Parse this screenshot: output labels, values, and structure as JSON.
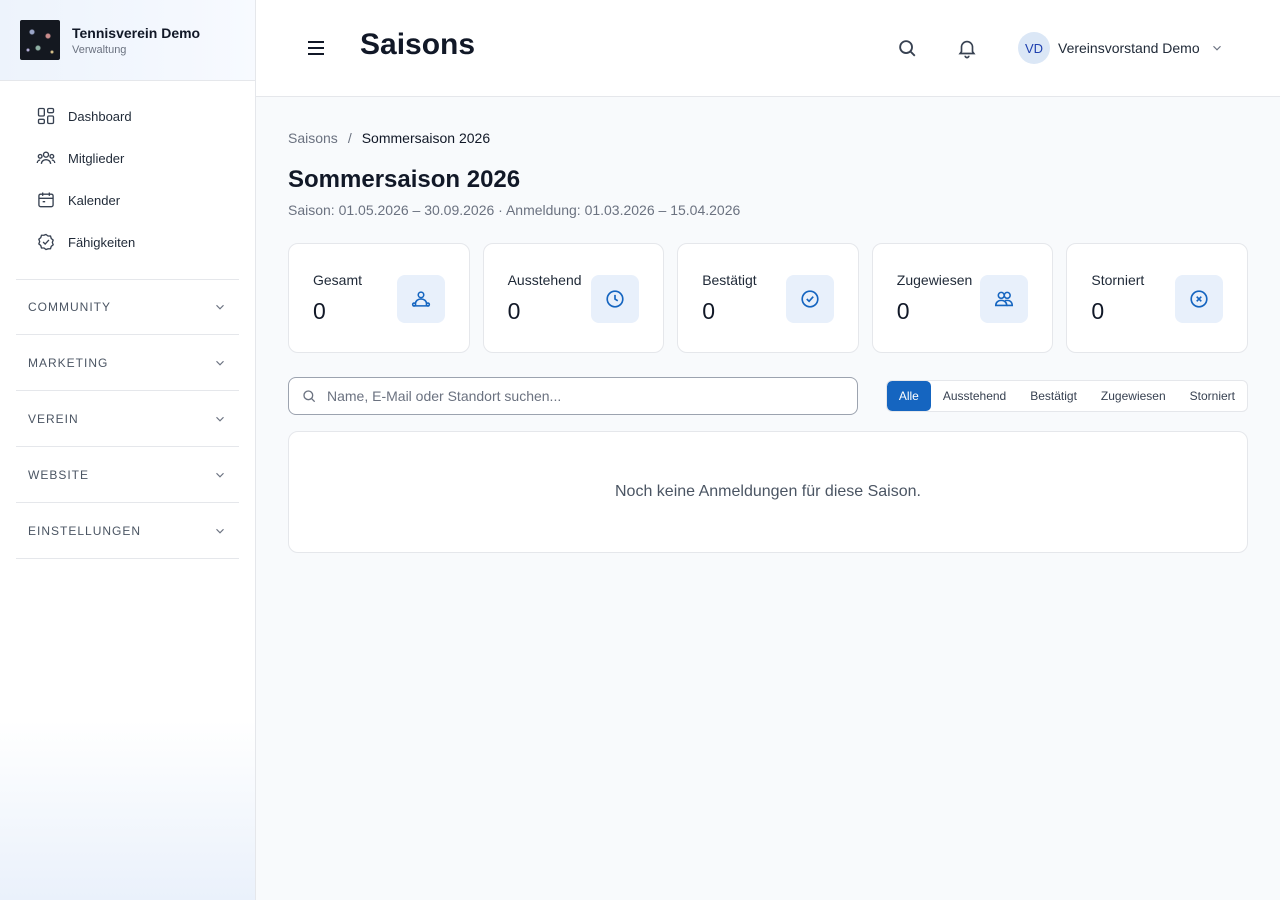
{
  "sidebar": {
    "brand_title": "Tennisverein Demo",
    "brand_sub": "Verwaltung",
    "items": [
      {
        "label": "Dashboard",
        "icon": "dashboard-icon"
      },
      {
        "label": "Mitglieder",
        "icon": "members-icon"
      },
      {
        "label": "Kalender",
        "icon": "calendar-icon"
      },
      {
        "label": "Fähigkeiten",
        "icon": "check-badge-icon"
      }
    ],
    "groups": [
      "COMMUNITY",
      "MARKETING",
      "VEREIN",
      "WEBSITE",
      "EINSTELLUNGEN"
    ]
  },
  "header": {
    "title": "Saisons",
    "user_initials": "VD",
    "user_name": "Vereinsvorstand Demo"
  },
  "breadcrumb": {
    "parent": "Saisons",
    "separator": "/",
    "current": "Sommersaison 2026"
  },
  "season": {
    "title": "Sommersaison 2026",
    "meta": "Saison: 01.05.2026 – 30.09.2026 · Anmeldung: 01.03.2026 – 15.04.2026"
  },
  "stats": [
    {
      "label": "Gesamt",
      "value": "0",
      "icon": "user-group-icon"
    },
    {
      "label": "Ausstehend",
      "value": "0",
      "icon": "clock-icon"
    },
    {
      "label": "Bestätigt",
      "value": "0",
      "icon": "check-circle-icon"
    },
    {
      "label": "Zugewiesen",
      "value": "0",
      "icon": "users-icon"
    },
    {
      "label": "Storniert",
      "value": "0",
      "icon": "x-circle-icon"
    }
  ],
  "search": {
    "placeholder": "Name, E-Mail oder Standort suchen...",
    "value": ""
  },
  "filters": {
    "options": [
      "Alle",
      "Ausstehend",
      "Bestätigt",
      "Zugewiesen",
      "Storniert"
    ],
    "selected": "Alle"
  },
  "empty_message": "Noch keine Anmeldungen für diese Saison.",
  "colors": {
    "accent": "#1565c0",
    "icon_bg": "#e8f0fb"
  }
}
